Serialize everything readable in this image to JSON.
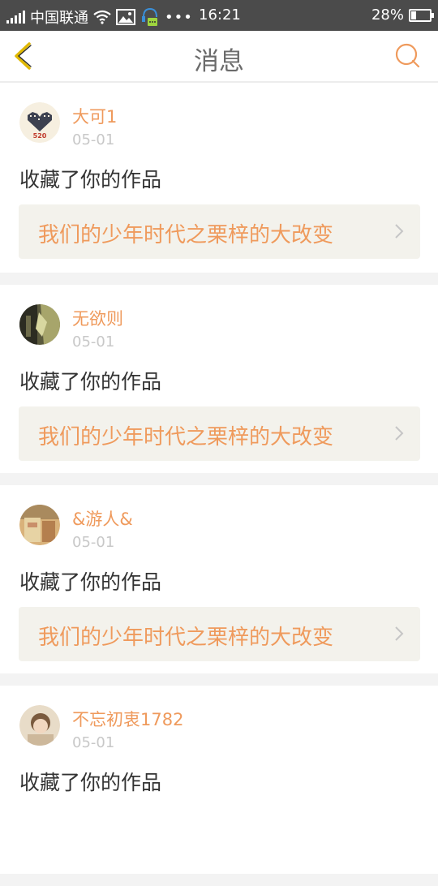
{
  "status": {
    "carrier": "中国联通",
    "time": "16:21",
    "battery_percent": "28%",
    "battery_level": 0.28,
    "icons": [
      "signal-icon",
      "wifi-icon",
      "image-icon",
      "notification-icon",
      "more-icon"
    ]
  },
  "header": {
    "title": "消息",
    "back_icon": "chevron-left-icon",
    "search_icon": "search-icon",
    "accent_color": "#ef9a5c"
  },
  "messages": [
    {
      "username": "大可1",
      "date": "05-01",
      "action": "收藏了你的作品",
      "work_title": "我们的少年时代之栗梓的大改变",
      "avatar_text": "520"
    },
    {
      "username": "无欲则",
      "date": "05-01",
      "action": "收藏了你的作品",
      "work_title": "我们的少年时代之栗梓的大改变"
    },
    {
      "username": "&游人&",
      "date": "05-01",
      "action": "收藏了你的作品",
      "work_title": "我们的少年时代之栗梓的大改变"
    },
    {
      "username": "不忘初衷1782",
      "date": "05-01",
      "action": "收藏了你的作品"
    }
  ]
}
